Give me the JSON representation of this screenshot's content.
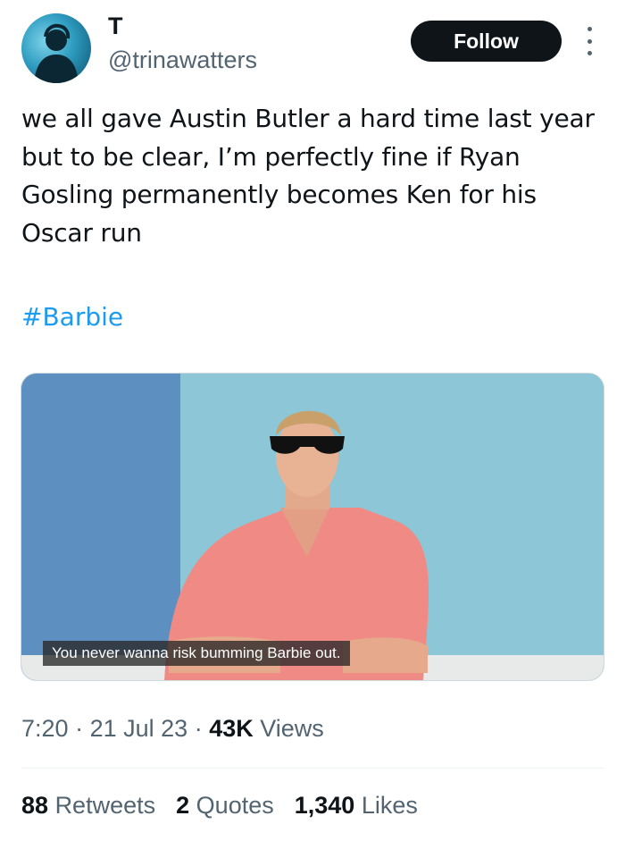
{
  "author": {
    "display_name": "T",
    "handle": "@trinawatters",
    "follow_label": "Follow"
  },
  "tweet": {
    "text": "we all gave Austin Butler a hard time last year but to be clear, I’m perfectly fine if Ryan Gosling permanently becomes Ken for his Oscar run",
    "hashtag": "#Barbie"
  },
  "media": {
    "caption": "You never wanna risk bumming Barbie out."
  },
  "meta": {
    "time": "7:20",
    "date": "21 Jul 23",
    "views_count": "43K",
    "views_label": "Views",
    "separator": "·"
  },
  "stats": {
    "retweets_count": "88",
    "retweets_label": "Retweets",
    "quotes_count": "2",
    "quotes_label": "Quotes",
    "likes_count": "1,340",
    "likes_label": "Likes"
  },
  "colors": {
    "link": "#1d9bf0",
    "follow_bg": "#0f1419",
    "secondary_text": "#536471"
  }
}
